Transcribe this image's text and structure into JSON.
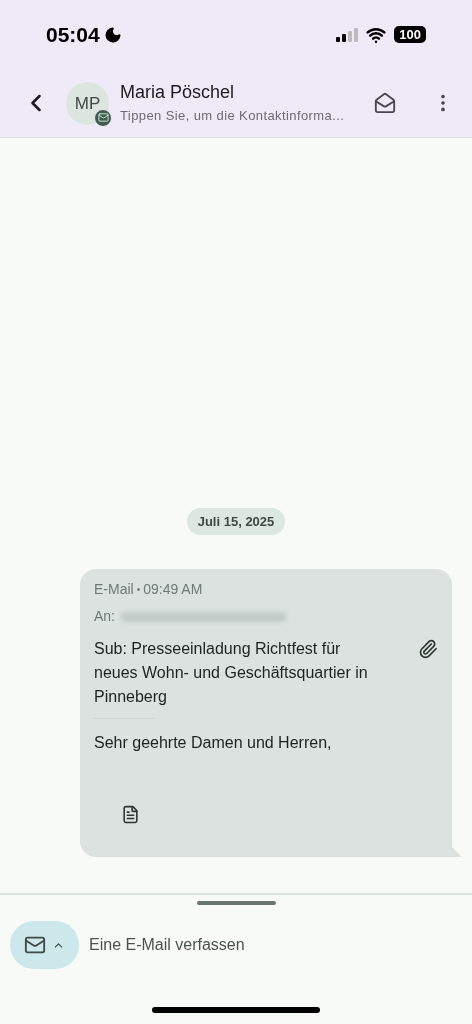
{
  "status_bar": {
    "time": "05:04",
    "battery": "100"
  },
  "header": {
    "initials": "MP",
    "name": "Maria Pöschel",
    "subtitle": "Tippen Sie, um die Kontaktinforma..."
  },
  "date_chip": "Juli 15, 2025",
  "message": {
    "channel": "E-Mail",
    "separator": "•",
    "time": "09:49 AM",
    "to_label": "An:",
    "subject": "Sub: Presseeinladung Richtfest für neues Wohn- und Geschäftsquartier in Pinneberg",
    "has_attachment": true,
    "body": "Sehr geehrte Damen und Herren,"
  },
  "composer": {
    "placeholder": "Eine E-Mail verfassen"
  }
}
